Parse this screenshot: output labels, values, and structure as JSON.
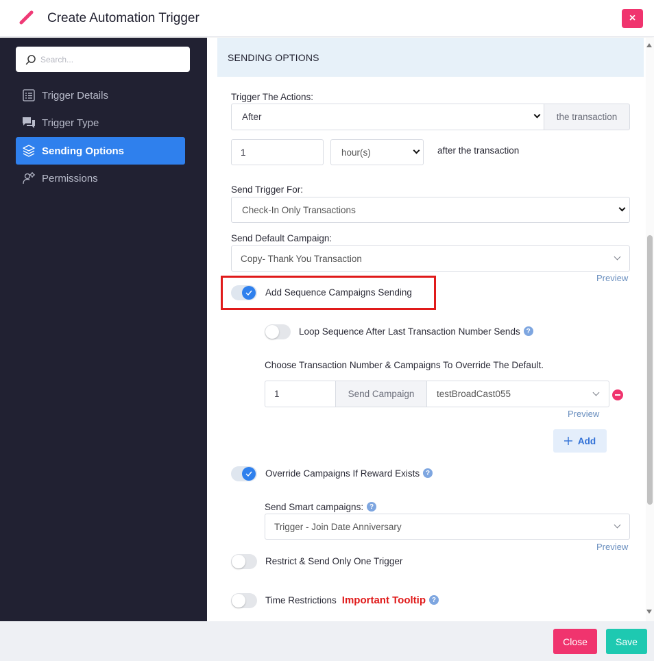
{
  "header": {
    "title": "Create Automation Trigger",
    "close_label": "×"
  },
  "sidebar": {
    "search_placeholder": "Search...",
    "items": [
      {
        "label": "Trigger Details",
        "icon": "list-icon",
        "active": false
      },
      {
        "label": "Trigger Type",
        "icon": "chat-icon",
        "active": false
      },
      {
        "label": "Sending Options",
        "icon": "layers-icon",
        "active": true
      },
      {
        "label": "Permissions",
        "icon": "user-gear-icon",
        "active": false
      }
    ]
  },
  "main": {
    "section_title": "SENDING OPTIONS",
    "trigger_actions": {
      "label": "Trigger The Actions:",
      "value": "After",
      "addon": "the transaction"
    },
    "delay": {
      "amount": "1",
      "unit": "hour(s)",
      "suffix": "after the transaction"
    },
    "send_trigger_for": {
      "label": "Send Trigger For:",
      "value": "Check-In Only Transactions"
    },
    "default_campaign": {
      "label": "Send Default Campaign:",
      "value": "Copy- Thank You Transaction",
      "preview": "Preview"
    },
    "sequence_toggle": {
      "label": "Add Sequence Campaigns Sending",
      "on": true
    },
    "loop_toggle": {
      "label": "Loop Sequence After Last Transaction Number Sends",
      "on": false,
      "help": "?"
    },
    "override_text": "Choose Transaction Number & Campaigns To Override The Default.",
    "sequence_row": {
      "number": "1",
      "addon": "Send Campaign",
      "campaign": "testBroadCast055",
      "preview": "Preview"
    },
    "add_label": "Add",
    "override_reward": {
      "label": "Override Campaigns If Reward Exists",
      "on": true,
      "help": "?"
    },
    "smart_campaigns": {
      "label": "Send Smart campaigns:",
      "value": "Trigger - Join Date Anniversary",
      "preview": "Preview",
      "help": "?"
    },
    "restrict_toggle": {
      "label": "Restrict & Send Only One Trigger",
      "on": false
    },
    "time_restrictions": {
      "label": "Time Restrictions",
      "important": "Important Tooltip",
      "on": false,
      "help": "?"
    }
  },
  "footer": {
    "close_label": "Close",
    "save_label": "Save"
  },
  "colors": {
    "sidebar_bg": "#212132",
    "accent": "#2f80ed",
    "danger": "#f0346e",
    "success": "#1ec9b1",
    "highlight": "#e01a1a"
  }
}
